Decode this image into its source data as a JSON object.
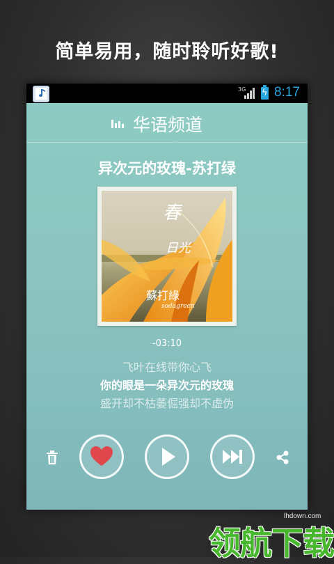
{
  "promo": {
    "headline": "简单易用，随时聆听好歌!"
  },
  "status_bar": {
    "network": "3G",
    "time": "8:17",
    "icons": [
      "music-app-icon",
      "signal-icon",
      "battery-charging-icon"
    ]
  },
  "header": {
    "channel_title": "华语频道",
    "channel_icon": "equalizer-icon"
  },
  "song": {
    "title": "异次元的玫瑰-苏打绿",
    "time_remaining": "-03:10"
  },
  "album": {
    "title_text": "春·日光",
    "artist_text": "蘇打綠 sodagreen"
  },
  "lyrics": {
    "previous": "飞叶在线带你心飞",
    "current": "你的眼是一朵异次元的玫瑰",
    "next": "盛开却不枯萎倔强却不虚伪"
  },
  "controls": {
    "trash": "trash-icon",
    "like": "heart-icon",
    "play": "play-icon",
    "next": "skip-next-icon",
    "share": "share-icon"
  },
  "watermark": {
    "site": "lhdown.com",
    "brand": "领航下载"
  },
  "colors": {
    "screen_bg": "#8cc4bf",
    "clock": "#29a7e1",
    "heart": "#e0474c",
    "watermark_green": "#47b82e"
  }
}
